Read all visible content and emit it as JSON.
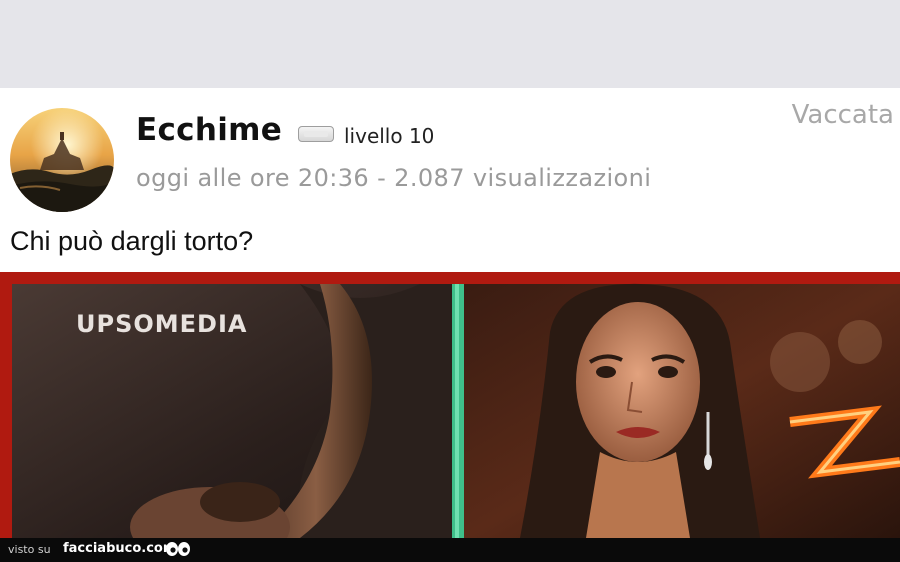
{
  "post": {
    "username": "Ecchime",
    "level": "livello 10",
    "meta": "oggi alle ore 20:36 - 2.087 visualizzazioni",
    "category": "Vaccata",
    "caption": "Chi può dargli torto?"
  },
  "media": {
    "watermark": "UPSOMEDIA"
  },
  "footer": {
    "label": "visto su",
    "brand": "facciabuco.com"
  }
}
